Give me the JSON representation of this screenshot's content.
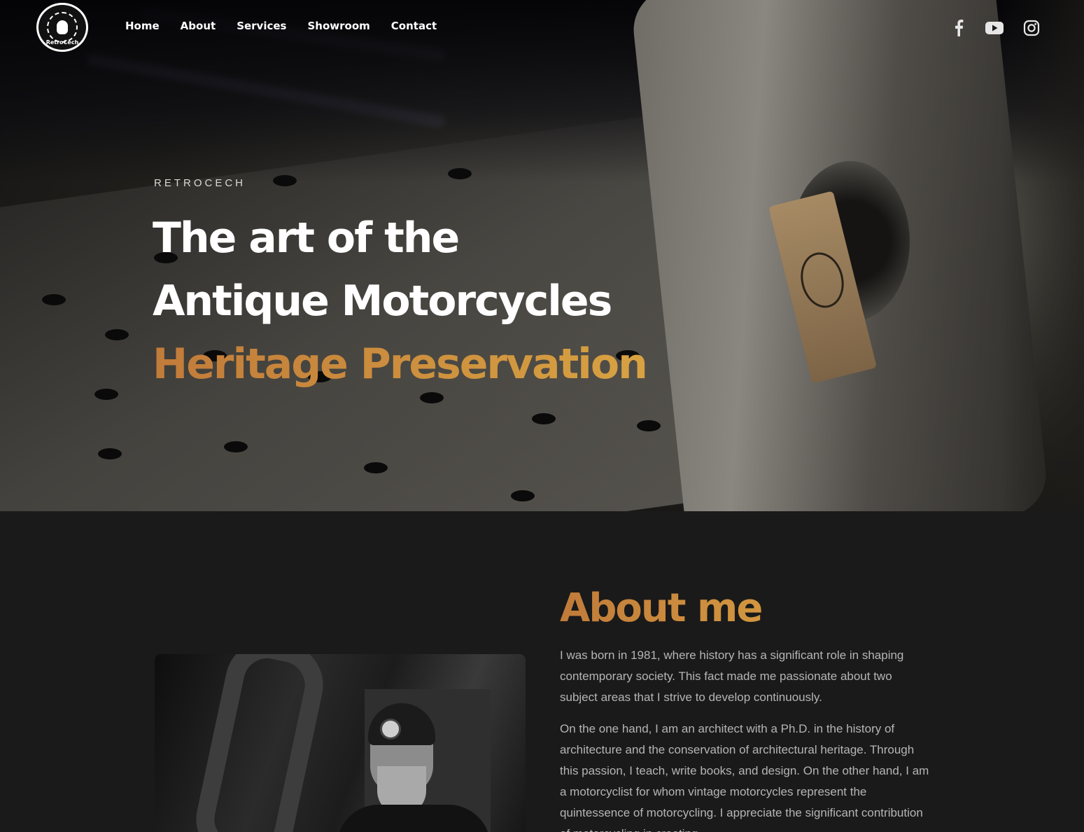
{
  "brand": {
    "logo_text": "RetroCech"
  },
  "nav": {
    "items": [
      "Home",
      "About",
      "Services",
      "Showroom",
      "Contact"
    ]
  },
  "social": [
    "facebook-icon",
    "youtube-icon",
    "instagram-icon"
  ],
  "hero": {
    "eyebrow": "RETROCECH",
    "line1": "The art of the",
    "line2": "Antique Motorcycles",
    "line3": "Heritage Preservation"
  },
  "about": {
    "title": "About me",
    "p1": "I was born in 1981, where history has a significant role in shaping contemporary society. This fact made me passionate about two subject areas that I strive to develop continuously.",
    "p2": "On the one hand, I am an architect with a Ph.D. in the history of architecture and the conservation of architectural heritage. Through this passion, I teach, write books, and design. On the other hand, I am a motorcyclist for whom vintage motorcycles represent the quintessence of motorcycling. I appreciate the significant contribution of motorcycling in creating"
  },
  "colors": {
    "accent_start": "#c17b3a",
    "accent_end": "#d8a242",
    "page_bg": "#1a1a1a"
  }
}
